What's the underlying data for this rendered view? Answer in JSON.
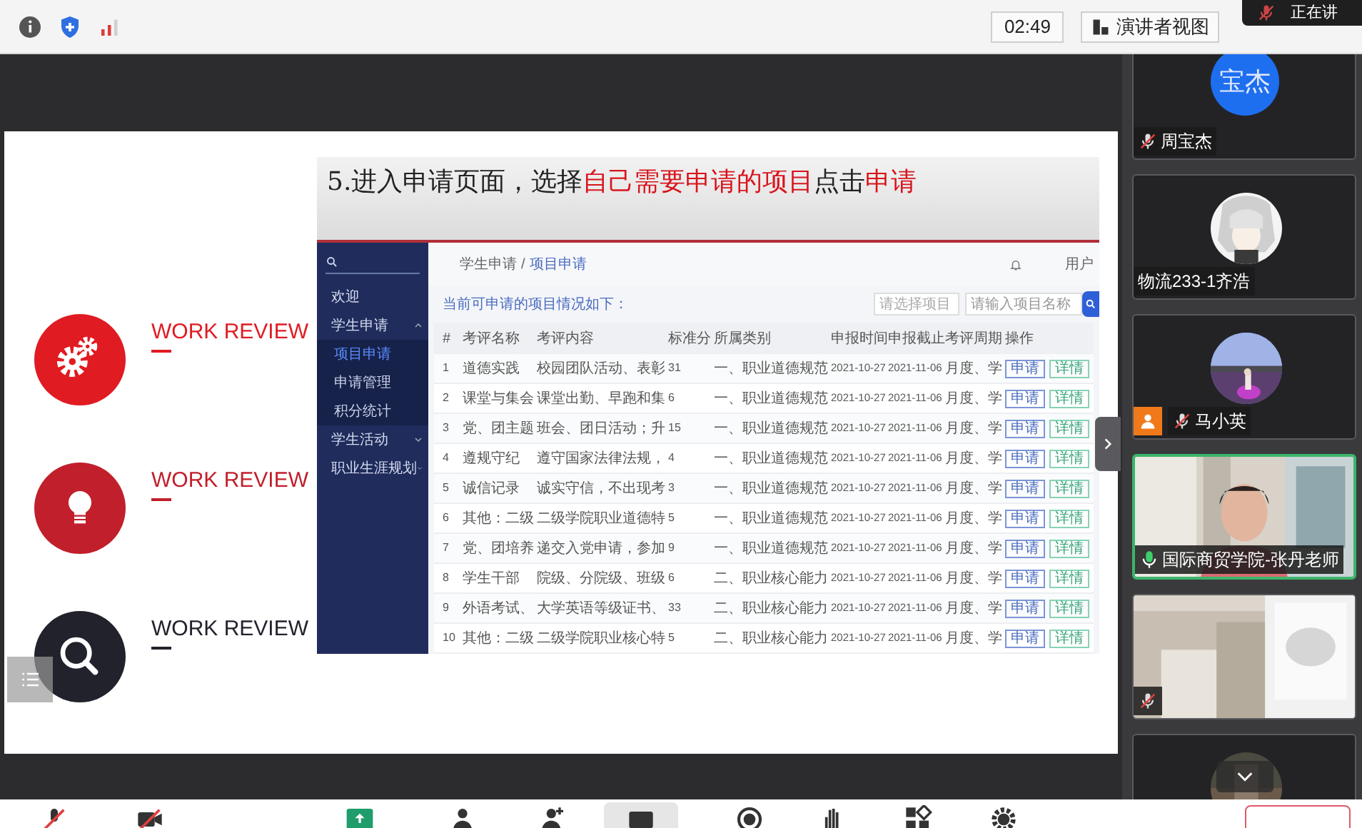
{
  "top_bar": {
    "timer": "02:49",
    "view_button": "演讲者视图",
    "speaking_label": "正在讲"
  },
  "slide": {
    "items": [
      {
        "label": "WORK REVIEW",
        "kind": "gears",
        "color": "#e01b22"
      },
      {
        "label": "WORK REVIEW",
        "kind": "bulb",
        "color": "#c11f2b"
      },
      {
        "label": "WORK REVIEW",
        "kind": "search",
        "color": "#22222c"
      }
    ],
    "screenshot": {
      "title": [
        {
          "text": "5.进入申请页面，选择",
          "highlight": false
        },
        {
          "text": "自己需要申请的项目",
          "highlight": true
        },
        {
          "text": "点击",
          "highlight": false
        },
        {
          "text": "申请",
          "highlight": true
        }
      ],
      "app": {
        "sidebar": [
          {
            "label": "欢迎",
            "kind": "link",
            "selected": false
          },
          {
            "label": "学生申请",
            "kind": "group",
            "selected": false,
            "expanded": true,
            "children": [
              {
                "label": "项目申请",
                "selected": true
              },
              {
                "label": "申请管理",
                "selected": false
              },
              {
                "label": "积分统计",
                "selected": false
              }
            ]
          },
          {
            "label": "学生活动",
            "kind": "group",
            "selected": false,
            "expanded": false
          },
          {
            "label": "职业生涯规划",
            "kind": "group",
            "selected": false,
            "expanded": false
          }
        ],
        "breadcrumb": [
          "学生申请",
          "/",
          "项目申请"
        ],
        "user": "用户",
        "heading": "当前可申请的项目情况如下：",
        "select_placeholder": "请选择项目",
        "search_placeholder": "请输入项目名称",
        "table": {
          "columns": [
            "#",
            "考评名称",
            "考评内容",
            "标准分",
            "所属类别",
            "申报时间",
            "申报截止",
            "考评周期",
            "操作"
          ],
          "rows": [
            {
              "cells": [
                "1",
                "道德实践",
                "校园团队活动、表彰",
                "31",
                "一、职业道德规范",
                "2021-10-27",
                "2021-11-06",
                "月度、学"
              ],
              "actions": [
                "申请",
                "详情"
              ]
            },
            {
              "cells": [
                "2",
                "课堂与集会",
                "课堂出勤、早跑和集",
                "6",
                "一、职业道德规范",
                "2021-10-27",
                "2021-11-06",
                "月度、学"
              ],
              "actions": [
                "申请",
                "详情"
              ]
            },
            {
              "cells": [
                "3",
                "党、团主题",
                "班会、团日活动；升",
                "15",
                "一、职业道德规范",
                "2021-10-27",
                "2021-11-06",
                "月度、学"
              ],
              "actions": [
                "申请",
                "详情"
              ]
            },
            {
              "cells": [
                "4",
                "遵规守纪",
                "遵守国家法律法规，",
                "4",
                "一、职业道德规范",
                "2021-10-27",
                "2021-11-06",
                "月度、学"
              ],
              "actions": [
                "申请",
                "详情"
              ]
            },
            {
              "cells": [
                "5",
                "诚信记录",
                "诚实守信，不出现考",
                "3",
                "一、职业道德规范",
                "2021-10-27",
                "2021-11-06",
                "月度、学"
              ],
              "actions": [
                "申请",
                "详情"
              ]
            },
            {
              "cells": [
                "6",
                "其他：二级",
                "二级学院职业道德特",
                "5",
                "一、职业道德规范",
                "2021-10-27",
                "2021-11-06",
                "月度、学"
              ],
              "actions": [
                "申请",
                "详情"
              ]
            },
            {
              "cells": [
                "7",
                "党、团培养",
                "递交入党申请，参加",
                "9",
                "一、职业道德规范",
                "2021-10-27",
                "2021-11-06",
                "月度、学"
              ],
              "actions": [
                "申请",
                "详情"
              ]
            },
            {
              "cells": [
                "8",
                "学生干部",
                "院级、分院级、班级",
                "6",
                "二、职业核心能力",
                "2021-10-27",
                "2021-11-06",
                "月度、学"
              ],
              "actions": [
                "申请",
                "详情"
              ]
            },
            {
              "cells": [
                "9",
                "外语考试、",
                "大学英语等级证书、",
                "33",
                "二、职业核心能力",
                "2021-10-27",
                "2021-11-06",
                "月度、学"
              ],
              "actions": [
                "申请",
                "详情"
              ]
            },
            {
              "cells": [
                "10",
                "其他：二级",
                "二级学院职业核心特",
                "5",
                "二、职业核心能力",
                "2021-10-27",
                "2021-11-06",
                "月度、学"
              ],
              "actions": [
                "申请",
                "详情"
              ]
            }
          ]
        }
      }
    }
  },
  "participants": [
    {
      "kind": "text-avatar",
      "avatar_text": "宝杰",
      "name": "周宝杰",
      "muted": true,
      "mic_on": false,
      "badge": false,
      "selected": false
    },
    {
      "kind": "avatar",
      "name": "物流233-1齐浩",
      "muted": false,
      "mic_on": false,
      "badge": false,
      "selected": false
    },
    {
      "kind": "avatar",
      "name": "马小英",
      "muted": true,
      "mic_on": false,
      "badge": true,
      "selected": false
    },
    {
      "kind": "video",
      "name": "国际商贸学院-张丹老师",
      "muted": false,
      "mic_on": true,
      "badge": false,
      "selected": true
    },
    {
      "kind": "video",
      "muted": true,
      "mic_on": false,
      "badge": false,
      "selected": false
    },
    {
      "kind": "avatar",
      "muted": false,
      "mic_on": false,
      "badge": false,
      "selected": false
    }
  ]
}
